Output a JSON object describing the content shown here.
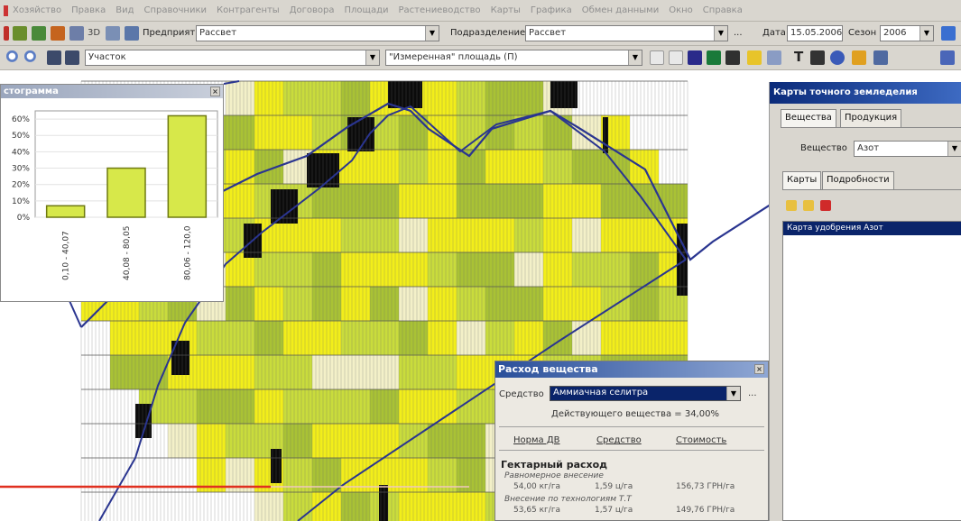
{
  "menu": {
    "items": [
      "Хозяйство",
      "Правка",
      "Вид",
      "Справочники",
      "Контрагенты",
      "Договора",
      "Площади",
      "Растениеводство",
      "Карты",
      "Графика",
      "Обмен данными",
      "Окно",
      "Справка"
    ]
  },
  "toolbar1": {
    "enterprise_label": "Предприятие",
    "enterprise_value": "Рассвет",
    "division_label": "Подразделение",
    "division_value": "Рассвет",
    "date_label": "Дата",
    "date_value": "15.05.2006",
    "season_label": "Сезон",
    "season_value": "2006",
    "dots": "..."
  },
  "toolbar2": {
    "layer_value": "Участок",
    "measure_value": "\"Измеренная\" площадь (П)"
  },
  "histogram": {
    "title": "стограмма",
    "close": "×"
  },
  "chart_data": {
    "type": "bar",
    "categories": [
      "0,10 - 40,07",
      "40,08 - 80,05",
      "80,06 - 120,0"
    ],
    "values": [
      7,
      30,
      62
    ],
    "yticks": [
      "0%",
      "10%",
      "20%",
      "30%",
      "40%",
      "50%",
      "60%"
    ],
    "ylim": [
      0,
      65
    ],
    "bar_color": "#d7e84a",
    "bar_edge": "#6f7a10",
    "grid": true
  },
  "right_panel": {
    "title": "Карты точного земледелия",
    "tab_substances": "Вещества",
    "tab_products": "Продукция",
    "substance_label": "Вещество",
    "substance_value": "Азот",
    "tab_maps": "Карты",
    "tab_details": "Подробности",
    "selected_item": "Карта удобрения Азот"
  },
  "dialog": {
    "title": "Расход вещества",
    "means_label": "Средство",
    "means_value": "Аммиачная селитра",
    "dots": "...",
    "active_substance": "Действующего вещества = 34,00%",
    "col_norm": "Норма ДВ",
    "col_means": "Средство",
    "col_cost": "Стоимость",
    "section": "Гектарный расход",
    "uniform_label": "Равномерное внесение",
    "uniform_norm": "54,00 кг/га",
    "uniform_means": "1,59 ц/га",
    "uniform_cost": "156,73 ГРН/га",
    "map_label": "Внесение по технологиям Т.Т",
    "map_norm": "53,65 кг/га",
    "map_means": "1,57 ц/га",
    "map_cost": "149,76 ГРН/га"
  },
  "colors": {
    "yellow": "#f2ee1a",
    "lightgreen": "#c9dc3c",
    "green": "#a9c235",
    "pale": "#f3f0c8",
    "black": "#0b0b0b",
    "boundary": "#2a3590",
    "redline": "#e03020"
  }
}
